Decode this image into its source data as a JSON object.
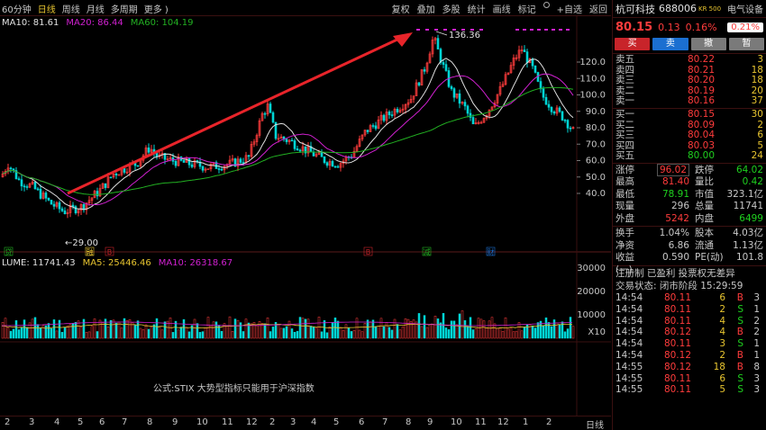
{
  "toolbar": {
    "left": [
      "60分钟",
      "日线",
      "周线",
      "月线",
      "多周期",
      "更多 )"
    ],
    "active_index": 1,
    "right": [
      "复权",
      "叠加",
      "多股",
      "统计",
      "画线",
      "标记",
      "+自选",
      "返回"
    ]
  },
  "ma": {
    "ma10": "MA10: 81.61",
    "ma20": "MA20: 86.44",
    "ma60": "MA60: 104.19"
  },
  "volume": {
    "volume": "LUME: 11741.43",
    "ma5": "MA5: 25446.46",
    "ma10": "MA10: 26318.67"
  },
  "price_axis": [
    "120.0",
    "110.0",
    "100.0",
    "90.0",
    "80.0",
    "70.0",
    "60.0",
    "50.0",
    "40.0"
  ],
  "vol_axis": [
    "30000",
    "20000",
    "10000",
    "X10"
  ],
  "annotations": {
    "high": "136.36",
    "low": "29.00"
  },
  "event_markers": [
    "贷",
    "融",
    "B",
    "B",
    "减",
    "财"
  ],
  "formula_note": "公式:STIX 大势型指标只能用于沪深指数",
  "x_axis": [
    "2",
    "3",
    "4",
    "5",
    "6",
    "7",
    "8",
    "9",
    "10",
    "11",
    "12",
    "2",
    "3",
    "4",
    "5",
    "6",
    "7",
    "8",
    "9",
    "10",
    "11",
    "12",
    "1",
    "2"
  ],
  "x_axis_end": "日线",
  "colors": {
    "up": "#ff3c3c",
    "down": "#00d5d5",
    "ma10": "#e0e0e0",
    "ma20": "#d020d0",
    "ma60": "#22b022",
    "arrow": "#e8242a"
  },
  "quote": {
    "name": "杭可科技",
    "code": "688006",
    "badge": "KR 500",
    "industry": "电气设备",
    "price": "80.15",
    "change": "0.13",
    "pct": "0.16%",
    "ratio": "0.21%"
  },
  "actions": [
    "买",
    "卖",
    "撤",
    "暂"
  ],
  "asks": [
    {
      "label": "卖五",
      "price": "80.22",
      "vol": "3"
    },
    {
      "label": "卖四",
      "price": "80.21",
      "vol": "18"
    },
    {
      "label": "卖三",
      "price": "80.20",
      "vol": "18"
    },
    {
      "label": "卖二",
      "price": "80.19",
      "vol": "20"
    },
    {
      "label": "卖一",
      "price": "80.16",
      "vol": "37"
    }
  ],
  "bids": [
    {
      "label": "买一",
      "price": "80.15",
      "vol": "30"
    },
    {
      "label": "买二",
      "price": "80.09",
      "vol": "2"
    },
    {
      "label": "买三",
      "price": "80.04",
      "vol": "6"
    },
    {
      "label": "买四",
      "price": "80.03",
      "vol": "5"
    },
    {
      "label": "买五",
      "price": "80.00",
      "vol": "24"
    }
  ],
  "stats": [
    {
      "k1": "涨停",
      "v1": "96.02",
      "c1": "red",
      "k2": "跌停",
      "v2": "64.02",
      "c2": "green"
    },
    {
      "k1": "最高",
      "v1": "81.40",
      "c1": "red",
      "k2": "量比",
      "v2": "0.42",
      "c2": "green"
    },
    {
      "k1": "最低",
      "v1": "78.91",
      "c1": "green",
      "k2": "市值",
      "v2": "323.1亿",
      "c2": "gray"
    },
    {
      "k1": "现量",
      "v1": "296",
      "c1": "gray",
      "k2": "总量",
      "v2": "11741",
      "c2": "gray"
    },
    {
      "k1": "外盘",
      "v1": "5242",
      "c1": "red",
      "k2": "内盘",
      "v2": "6499",
      "c2": "green"
    }
  ],
  "stats2": [
    {
      "k1": "换手",
      "v1": "1.04%",
      "k2": "股本",
      "v2": "4.03亿"
    },
    {
      "k1": "净资",
      "v1": "6.86",
      "k2": "流通",
      "v2": "1.13亿"
    },
    {
      "k1": "收益(一)",
      "v1": "0.590",
      "k2": "PE(动)",
      "v2": "101.8"
    }
  ],
  "info": {
    "line1": "注册制  已盈利  投票权无差异",
    "line2": "交易状态: 闭市阶段 15:29:59"
  },
  "trades": [
    {
      "time": "14:54",
      "price": "80.11",
      "qty": "6",
      "dir": "B",
      "n": "3"
    },
    {
      "time": "14:54",
      "price": "80.11",
      "qty": "2",
      "dir": "S",
      "n": "1"
    },
    {
      "time": "14:54",
      "price": "80.11",
      "qty": "4",
      "dir": "S",
      "n": "2"
    },
    {
      "time": "14:54",
      "price": "80.12",
      "qty": "4",
      "dir": "B",
      "n": "2"
    },
    {
      "time": "14:54",
      "price": "80.11",
      "qty": "3",
      "dir": "S",
      "n": "1"
    },
    {
      "time": "14:54",
      "price": "80.12",
      "qty": "2",
      "dir": "B",
      "n": "1"
    },
    {
      "time": "14:55",
      "price": "80.12",
      "qty": "18",
      "dir": "B",
      "n": "8"
    },
    {
      "time": "14:55",
      "price": "80.11",
      "qty": "6",
      "dir": "S",
      "n": "3"
    },
    {
      "time": "14:55",
      "price": "80.11",
      "qty": "5",
      "dir": "S",
      "n": "3"
    }
  ]
}
